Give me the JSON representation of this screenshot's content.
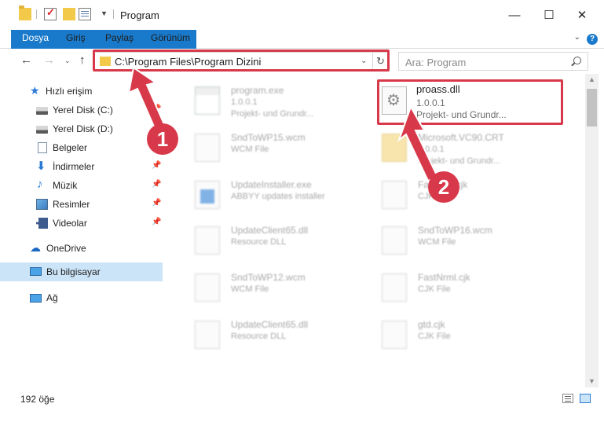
{
  "window": {
    "title": "Program",
    "minimize": "—",
    "maximize": "☐",
    "close": "✕"
  },
  "ribbon": {
    "tabs": [
      "Dosya",
      "Giriş",
      "Paylaş",
      "Görünüm"
    ],
    "help": "?",
    "collapse": "⌄"
  },
  "navigation": {
    "back": "←",
    "forward": "→",
    "recent": "⌄",
    "up": "↑",
    "address": "C:\\Program Files\\Program Dizini",
    "address_dropdown": "⌄",
    "refresh": "↻",
    "search_placeholder": "Ara: Program"
  },
  "sidebar": {
    "items": [
      {
        "label": "Hızlı erişim",
        "icon": "star-icon"
      },
      {
        "label": "Yerel Disk (C:)",
        "icon": "drive-icon",
        "pin": "📌"
      },
      {
        "label": "Yerel Disk (D:)",
        "icon": "drive-icon"
      },
      {
        "label": "Belgeler",
        "icon": "documents-icon"
      },
      {
        "label": "İndirmeler",
        "icon": "download-icon",
        "pin": "📌"
      },
      {
        "label": "Müzik",
        "icon": "music-icon",
        "pin": "📌"
      },
      {
        "label": "Resimler",
        "icon": "pictures-icon",
        "pin": "📌"
      },
      {
        "label": "Videolar",
        "icon": "videos-icon",
        "pin": "📌"
      },
      {
        "label": "OneDrive",
        "icon": "cloud-icon"
      },
      {
        "label": "Bu bilgisayar",
        "icon": "computer-icon"
      },
      {
        "label": "Ağ",
        "icon": "network-icon"
      }
    ]
  },
  "files": [
    {
      "name": "program.exe",
      "line1": "1.0.0.1",
      "line2": "Projekt- und Grundr...",
      "icon": "exe-icon",
      "blurred": true
    },
    {
      "name": "proass.dll",
      "line1": "1.0.0.1",
      "line2": "Projekt- und Grundr...",
      "icon": "dll-icon",
      "blurred": false
    },
    {
      "name": "SndToWP15.wcm",
      "line1": "WCM File",
      "line2": "",
      "icon": "file-icon",
      "blurred": true
    },
    {
      "name": "Microsoft.VC90.CRT",
      "line1": "1.0.0.1",
      "line2": "Projekt- und Grundr...",
      "icon": "folder-icon",
      "blurred": true
    },
    {
      "name": "UpdateInstaller.exe",
      "line1": "ABBYY updates installer",
      "line2": "",
      "icon": "exe-icon",
      "blurred": true
    },
    {
      "name": "FastNeo.cjk",
      "line1": "CJK File",
      "line2": "",
      "icon": "file-icon",
      "blurred": true
    },
    {
      "name": "UpdateClient65.dll",
      "line1": "Resource DLL",
      "line2": "",
      "icon": "file-icon",
      "blurred": true
    },
    {
      "name": "SndToWP16.wcm",
      "line1": "WCM File",
      "line2": "",
      "icon": "file-icon",
      "blurred": true
    },
    {
      "name": "SndToWP12.wcm",
      "line1": "WCM File",
      "line2": "",
      "icon": "file-icon",
      "blurred": true
    },
    {
      "name": "FastNrml.cjk",
      "line1": "CJK File",
      "line2": "",
      "icon": "file-icon",
      "blurred": true
    },
    {
      "name": "UpdateClient65.dll",
      "line1": "Resource DLL",
      "line2": "",
      "icon": "file-icon",
      "blurred": true
    },
    {
      "name": "gtd.cjk",
      "line1": "CJK File",
      "line2": "",
      "icon": "file-icon",
      "blurred": true
    }
  ],
  "status": {
    "item_count": "192 öğe"
  },
  "annotations": {
    "step1": "1",
    "step2": "2",
    "color": "#d8394a"
  }
}
